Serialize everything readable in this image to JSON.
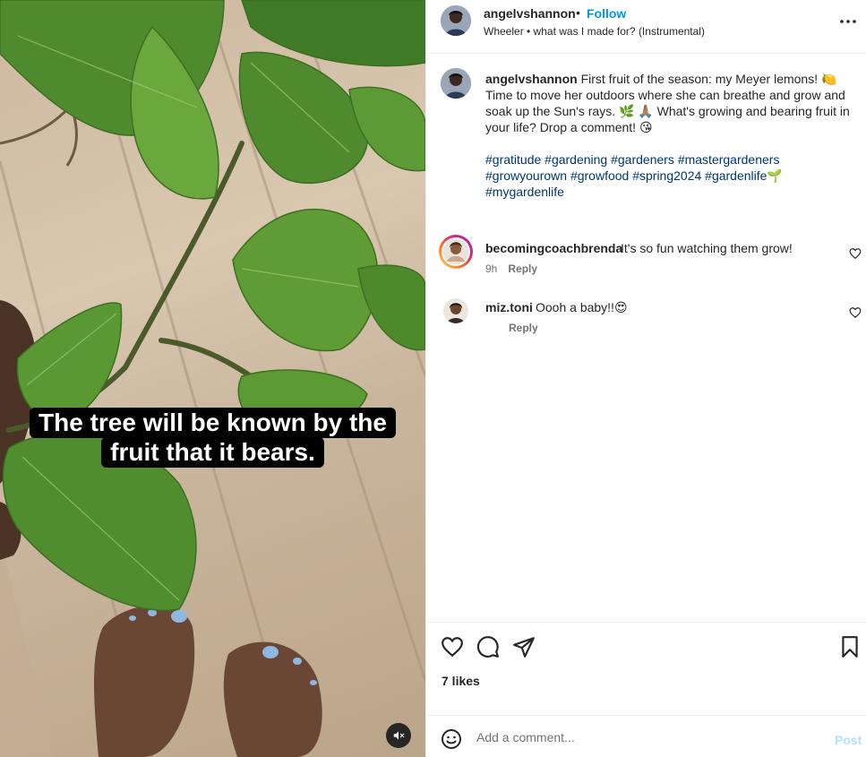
{
  "media": {
    "caption_line1": "The tree will be known by the",
    "caption_line2": "fruit that it bears.",
    "mute_icon": "speaker-muted-icon"
  },
  "header": {
    "username": "angelvshannon",
    "separator": "•",
    "follow_label": "Follow",
    "audio": "Wheeler • what was I made for? (Instrumental)",
    "more_icon": "more-horizontal-icon"
  },
  "caption": {
    "username": "angelvshannon",
    "text": "First fruit of the season: my Meyer lemons! 🍋 Time to move her outdoors where she can breathe and grow and soak up the Sun's rays. 🌿 🙏🏽 What's growing and bearing fruit in your life? Drop a comment! 😘",
    "hashtags": "#gratitude #gardening #gardeners #mastergardeners #growyourown #growfood #spring2024 #gardenlife🌱 #mygardenlife"
  },
  "comments": [
    {
      "username": "becomingcoachbrenda",
      "text": "It's so fun watching them grow!",
      "time": "9h",
      "reply_label": "Reply"
    },
    {
      "username": "miz.toni",
      "text": "Oooh a baby!!😍",
      "time": "",
      "reply_label": "Reply"
    }
  ],
  "actions": {
    "like_icon": "heart-icon",
    "comment_icon": "comment-bubble-icon",
    "share_icon": "send-icon",
    "save_icon": "bookmark-icon",
    "likes": "7 likes"
  },
  "add_comment": {
    "placeholder": "Add a comment...",
    "post_label": "Post",
    "emoji_icon": "emoji-smile-icon"
  },
  "colors": {
    "accent": "#0095f6",
    "hashtag": "#00376b",
    "muted_text": "#737373",
    "post_disabled": "#b2dffc"
  }
}
